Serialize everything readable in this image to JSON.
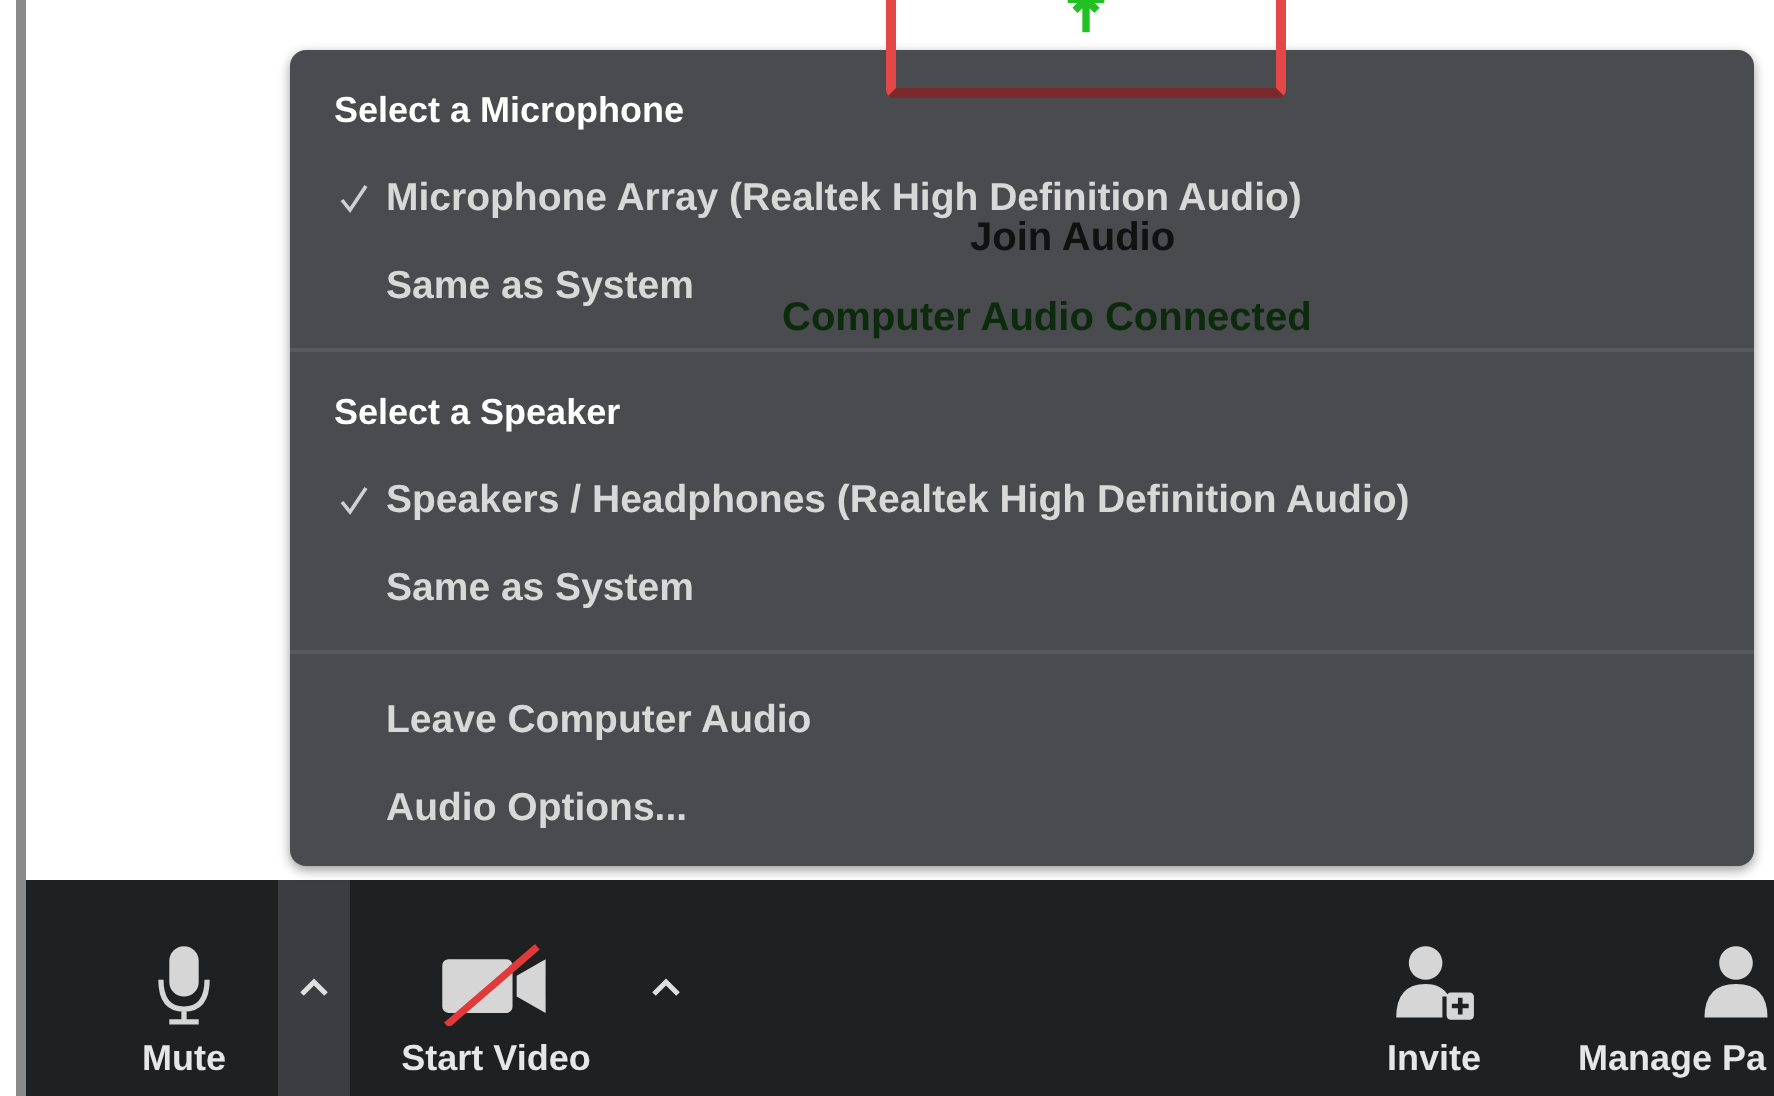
{
  "background": {
    "title": "Join Audio",
    "status": "Computer Audio Connected"
  },
  "menu": {
    "sections": [
      {
        "heading": "Select a Microphone",
        "items": [
          {
            "label": "Microphone Array (Realtek High Definition Audio)",
            "selected": true
          },
          {
            "label": "Same as System",
            "selected": false
          }
        ]
      },
      {
        "heading": "Select a Speaker",
        "items": [
          {
            "label": "Speakers / Headphones (Realtek High Definition Audio)",
            "selected": true
          },
          {
            "label": "Same as System",
            "selected": false
          }
        ]
      },
      {
        "items": [
          {
            "label": "Leave Computer Audio"
          },
          {
            "label": "Audio Options..."
          }
        ]
      }
    ]
  },
  "toolbar": {
    "left": [
      {
        "kind": "button",
        "label": "Mute"
      },
      {
        "kind": "caret",
        "selected": true
      },
      {
        "kind": "button",
        "label": "Start Video"
      },
      {
        "kind": "caret",
        "selected": false
      }
    ],
    "right": [
      {
        "kind": "button",
        "label": "Invite"
      },
      {
        "kind": "button",
        "label": "Manage Pa"
      }
    ]
  }
}
